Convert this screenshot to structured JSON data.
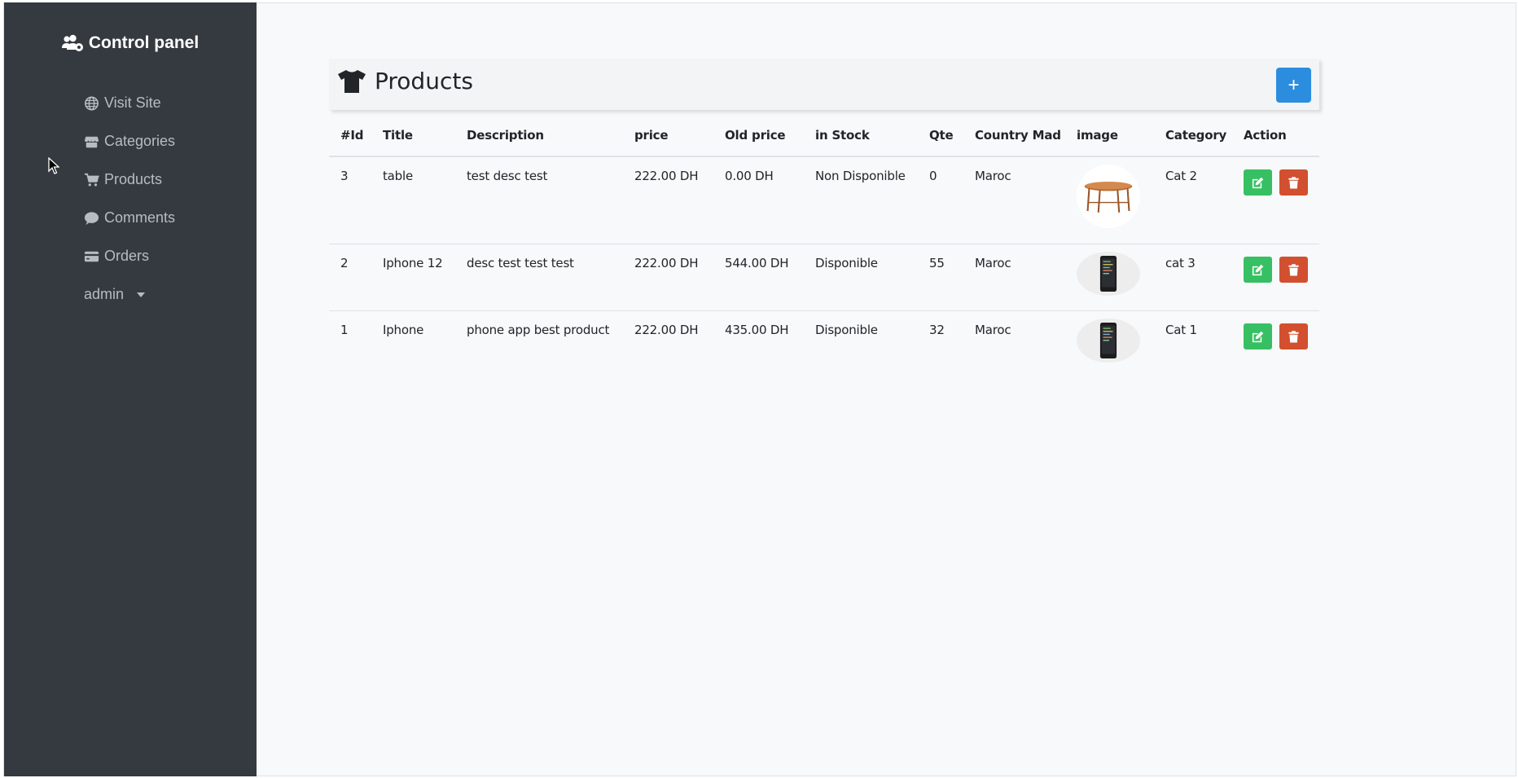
{
  "sidebar": {
    "brand": "Control panel",
    "items": [
      {
        "label": "Visit Site",
        "icon": "globe-icon"
      },
      {
        "label": "Categories",
        "icon": "store-icon"
      },
      {
        "label": "Products",
        "icon": "cart-icon"
      },
      {
        "label": "Comments",
        "icon": "comment-icon"
      },
      {
        "label": "Orders",
        "icon": "credit-card-icon"
      }
    ],
    "user": "admin"
  },
  "products": {
    "title": "Products",
    "add_label": "+",
    "columns": [
      "#Id",
      "Title",
      "Description",
      "price",
      "Old price",
      "in Stock",
      "Qte",
      "Country Mad",
      "image",
      "Category",
      "Action"
    ],
    "rows": [
      {
        "id": "3",
        "title": "table",
        "description": "test desc test",
        "price": "222.00 DH",
        "old_price": "0.00 DH",
        "stock": "Non Disponible",
        "qte": "0",
        "country": "Maroc",
        "image": "table",
        "category": "Cat 2"
      },
      {
        "id": "2",
        "title": "Iphone 12",
        "description": "desc test test test",
        "price": "222.00 DH",
        "old_price": "544.00 DH",
        "stock": "Disponible",
        "qte": "55",
        "country": "Maroc",
        "image": "phone",
        "category": "cat 3"
      },
      {
        "id": "1",
        "title": "Iphone",
        "description": "phone app best product",
        "price": "222.00 DH",
        "old_price": "435.00 DH",
        "stock": "Disponible",
        "qte": "32",
        "country": "Maroc",
        "image": "phone",
        "category": "Cat 1"
      }
    ]
  },
  "colors": {
    "sidebar_bg": "#343a40",
    "add_button": "#2c8ddf",
    "edit_button": "#37c063",
    "delete_button": "#d2502f"
  }
}
